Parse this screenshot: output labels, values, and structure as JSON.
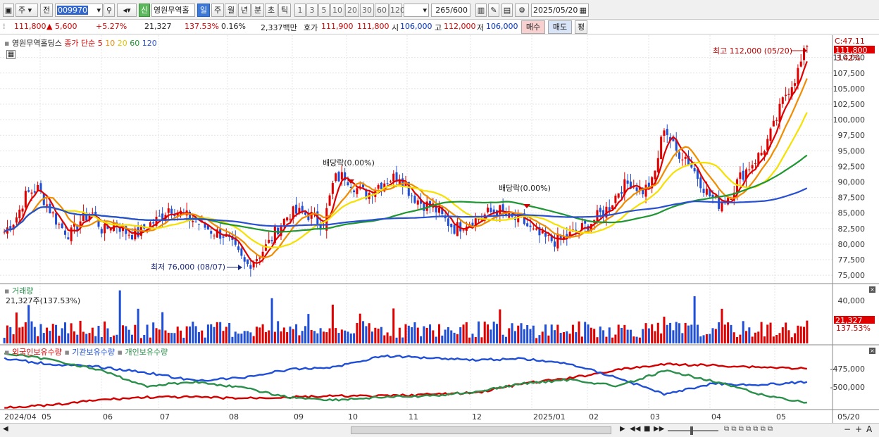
{
  "toolbar": {
    "type_select": "주",
    "prev_label": "전",
    "code_value": "009970",
    "new_badge": "신",
    "stock_name": "영원무역홀",
    "periods": [
      "일",
      "주",
      "월",
      "년",
      "분",
      "초",
      "틱"
    ],
    "active_period": "일",
    "intervals": [
      "1",
      "3",
      "5",
      "10",
      "20",
      "30",
      "60",
      "120"
    ],
    "count_value": "265",
    "count_total": "/600",
    "date_value": "2025/05/20"
  },
  "quote": {
    "price": "111,800",
    "change": "▲ 5,600",
    "change_pct": "+5.27%",
    "volume": "21,327",
    "volume_ratio": "137.53%",
    "turnover_pct": "0.16%",
    "amount": "2,337백만",
    "hoga_label": "호가",
    "ask": "111,900",
    "bid": "111,800",
    "open_label": "시",
    "open": "106,000",
    "high_label": "고",
    "high": "112,000",
    "low_label": "저",
    "low": "106,000",
    "buy_label": "매수",
    "sell_label": "매도",
    "eval_label": "평"
  },
  "price_panel": {
    "name": "영원무역홀딩스",
    "ma_label": "종가 단순",
    "ma_periods": [
      "5",
      "10",
      "20",
      "60",
      "120"
    ],
    "ma_colors": [
      "#e00000",
      "#f08c00",
      "#f5e000",
      "#1e9632",
      "#2850d2"
    ],
    "c_label": "C:47.11",
    "last_price_box": "111,800",
    "last_change_box": "3.42%",
    "high_annot": "최고 112,000 (05/20)",
    "low_annot": "최저 76,000 (08/07)",
    "div_annot_1": "배당락(0.00%)",
    "div_annot_2": "배당락(0.00%)"
  },
  "volume_panel": {
    "title": "거래량",
    "value_text": "21,327주(137.53%)",
    "axis_label": "40,000",
    "last_box": "21,327",
    "ratio_box": "137.53%"
  },
  "holding_panel": {
    "series_labels": [
      "외국인보유수량",
      "기관보유수량",
      "개인보유수량"
    ],
    "series_colors": [
      "#d40000",
      "#1f4fd6",
      "#2a8f4a"
    ],
    "axis_labels": [
      "-475,000",
      "-500,000"
    ]
  },
  "x_labels": [
    "2024/04",
    "05",
    "06",
    "07",
    "08",
    "09",
    "10",
    "11",
    "12",
    "2025/01",
    "02",
    "03",
    "04",
    "05",
    "05/20"
  ],
  "chart_data": {
    "type": "line",
    "y_ticks": [
      75000,
      77500,
      80000,
      82500,
      85000,
      87500,
      90000,
      92500,
      95000,
      97500,
      100000,
      102500,
      105000,
      107500,
      110000
    ],
    "ylim": [
      74000,
      112000
    ],
    "close": [
      82000,
      84000,
      88000,
      89000,
      86000,
      83000,
      81500,
      84000,
      85000,
      82000,
      83500,
      82000,
      81500,
      83000,
      84000,
      86000,
      85000,
      84000,
      83000,
      82000,
      81500,
      79000,
      76500,
      78000,
      80000,
      83000,
      85000,
      85000,
      84500,
      83000,
      90500,
      91000,
      89000,
      88000,
      89500,
      90500,
      91000,
      88000,
      86500,
      86000,
      84000,
      82500,
      83500,
      84000,
      85000,
      85500,
      84000,
      84000,
      82000,
      81000,
      80500,
      81000,
      82000,
      83000,
      84500,
      86000,
      89000,
      90000,
      88500,
      90000,
      99000,
      95000,
      94000,
      91000,
      88000,
      86500,
      88000,
      91000,
      93000,
      95000,
      99000,
      104000,
      107000,
      111800
    ],
    "volume_axis": [
      40000
    ],
    "last_volume": 21327
  },
  "nav": {
    "first_label": "▶",
    "zoom_plus": "+",
    "zoom_minus": "−",
    "auto_label": "A"
  }
}
